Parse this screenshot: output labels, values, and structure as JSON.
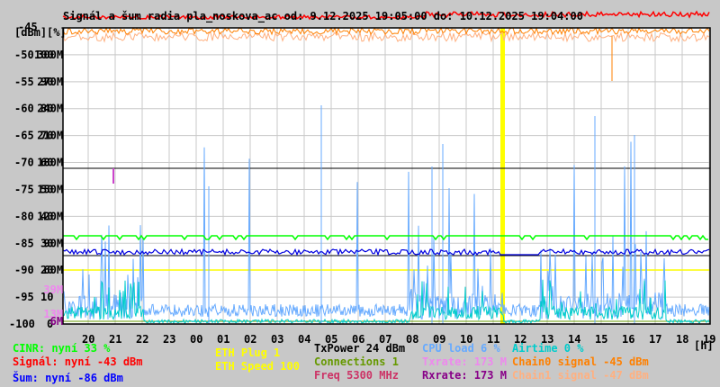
{
  "chart_data": {
    "type": "line",
    "title": "Signál a šum radia pla_noskova_ac od: 9.12.2025 19:05:00 do: 10.12.2025 19:04:00",
    "ylabel_units": [
      "[dBm]",
      "[%]"
    ],
    "xlabel": "[h]",
    "x_ticks": [
      "20",
      "21",
      "22",
      "23",
      "00",
      "01",
      "02",
      "03",
      "04",
      "05",
      "06",
      "07",
      "08",
      "09",
      "10",
      "11",
      "12",
      "13",
      "14",
      "15",
      "16",
      "17",
      "18",
      "19"
    ],
    "y_ticks_dbm": [
      "-45",
      "-50",
      "-55",
      "-60",
      "-65",
      "-70",
      "-75",
      "-80",
      "-85",
      "-90",
      "-95",
      "-100"
    ],
    "y_ticks_pct": [
      "100",
      "90",
      "80",
      "70",
      "60",
      "50",
      "40",
      "30",
      "20",
      "10",
      "0"
    ],
    "y_ticks_rate": [
      "300M",
      "270M",
      "240M",
      "210M",
      "180M",
      "150M",
      "120M",
      "90M",
      "60M"
    ],
    "rate_markers": [
      "39M",
      "13M",
      "6M"
    ],
    "ylim_dbm": [
      -100,
      -45
    ],
    "grid": true,
    "series": [
      {
        "name": "Signál",
        "color": "#ff0000",
        "approx_dbm": -43
      },
      {
        "name": "Chain0 signal",
        "color": "#ff8000",
        "approx_dbm": -45
      },
      {
        "name": "Chain1 signal",
        "color": "#ffb080",
        "approx_dbm": -47
      },
      {
        "name": "CINR",
        "color": "#00ff00",
        "approx_pct": 33
      },
      {
        "name": "Šum",
        "color": "#0000e0",
        "approx_dbm": -86
      },
      {
        "name": "CPU load",
        "color": "#66aaff",
        "approx_pct": 6
      },
      {
        "name": "Airtime",
        "color": "#00cccc",
        "approx_pct": 0
      },
      {
        "name": "TxPower",
        "color": "#000000",
        "approx_dbm": 24
      }
    ],
    "legend_placement": "bottom"
  },
  "legend": {
    "cinr": "CINR: nyní 33 %",
    "signal": "Signál: nyní -43 dBm",
    "noise": "Šum: nyní -86 dBm",
    "eth_plug": "ETH Plug 1",
    "eth_speed": "ETH Speed 100",
    "txpower": "TxPower 24 dBm",
    "connections": "Connections 1",
    "freq": "Freq 5300 MHz",
    "cpu": "CPU load 6 %",
    "txrate": "Txrate: 173 M",
    "rxrate": "Rxrate: 173 M",
    "airtime": "Airtime 0 %",
    "chain0": "Chain0 signal -45 dBm",
    "chain1": "Chain1 signal -47 dBm"
  },
  "colors": {
    "cinr": "#00ff00",
    "signal": "#ff0000",
    "noise": "#0000ff",
    "eth": "#ffff00",
    "txpower": "#000000",
    "connections": "#669900",
    "freq": "#cc3366",
    "cpu": "#66aaff",
    "txrate": "#ee88ee",
    "rxrate": "#880088",
    "airtime": "#00cccc",
    "chain0": "#ff8000",
    "chain1": "#ffb080"
  }
}
